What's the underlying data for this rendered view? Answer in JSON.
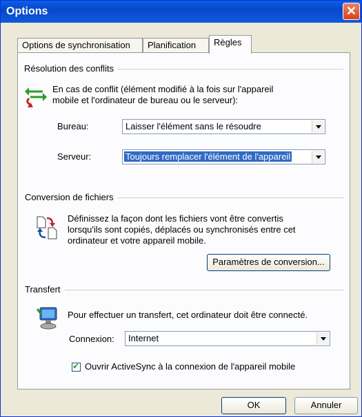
{
  "window": {
    "title": "Options",
    "close_glyph": "✕"
  },
  "tabs": [
    {
      "label": "Options de synchronisation"
    },
    {
      "label": "Planification"
    },
    {
      "label": "Règles",
      "active": true
    }
  ],
  "conflicts": {
    "heading": "Résolution des conflits",
    "icon": "conflict-arrows-icon",
    "description_line1": "En cas de conflit (élément modifié à la fois sur l'appareil",
    "description_line2": "mobile et l'ordinateur de bureau ou le serveur):",
    "bureau_label": "Bureau:",
    "bureau_value": "Laisser l'élément sans le résoudre",
    "serveur_label": "Serveur:",
    "serveur_value": "Toujours remplacer l'élément de l'appareil"
  },
  "conversion": {
    "heading": "Conversion de fichiers",
    "icon": "file-conversion-icon",
    "description_line1": "Définissez la façon dont les fichiers vont être convertis",
    "description_line2": "lorsqu'ils sont copiés, déplacés ou synchronisés entre cet",
    "description_line3": "ordinateur et votre appareil mobile.",
    "button_label": "Paramètres de conversion..."
  },
  "transfer": {
    "heading": "Transfert",
    "icon": "computer-connection-icon",
    "description": "Pour effectuer un transfert, cet ordinateur doit être connecté.",
    "connection_label": "Connexion:",
    "connection_value": "Internet",
    "checkbox_label": "Ouvrir ActiveSync à la connexion de l'appareil mobile",
    "checkbox_checked": true
  },
  "footer": {
    "ok_label": "OK",
    "cancel_label": "Annuler"
  },
  "colors": {
    "titlebar": "#0a54d8",
    "selection": "#316ac5",
    "dialog_bg": "#ece9d8"
  }
}
